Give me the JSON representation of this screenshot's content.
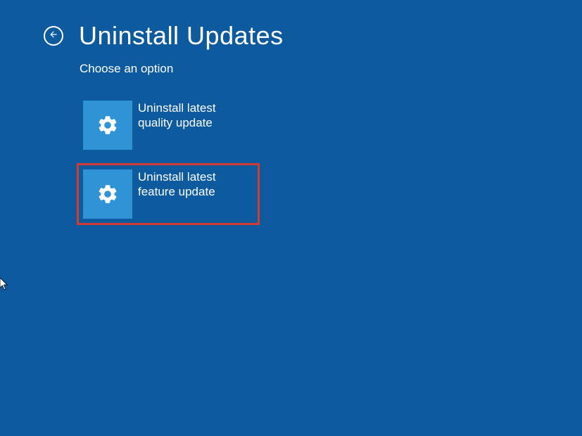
{
  "page": {
    "title": "Uninstall Updates",
    "subtitle": "Choose an option"
  },
  "options": {
    "quality": {
      "label": "Uninstall latest quality update",
      "icon": "gear"
    },
    "feature": {
      "label": "Uninstall latest feature update",
      "icon": "gear"
    }
  }
}
